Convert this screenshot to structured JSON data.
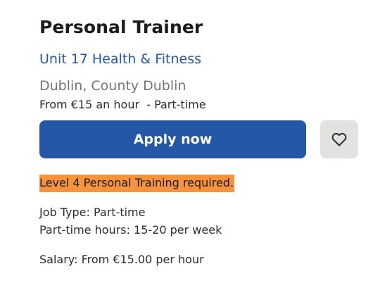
{
  "job": {
    "title": "Personal Trainer",
    "company": "Unit 17 Health & Fitness",
    "location": "Dublin, County Dublin",
    "salary_summary": "From €15 an hour",
    "separator": "  - ",
    "job_type_summary": "Part-time"
  },
  "actions": {
    "apply_label": "Apply now",
    "save_icon": "heart-outline-icon"
  },
  "description": {
    "highlight": "Level 4 Personal Training required.",
    "job_type": "Job Type: Part-time",
    "hours": "Part-time hours: 15-20 per week",
    "salary": "Salary: From €15.00 per hour"
  },
  "colors": {
    "brand_blue": "#2557a7",
    "highlight_orange": "#f6933b",
    "save_button_bg": "#e4e2e0",
    "muted_text": "#767676"
  }
}
